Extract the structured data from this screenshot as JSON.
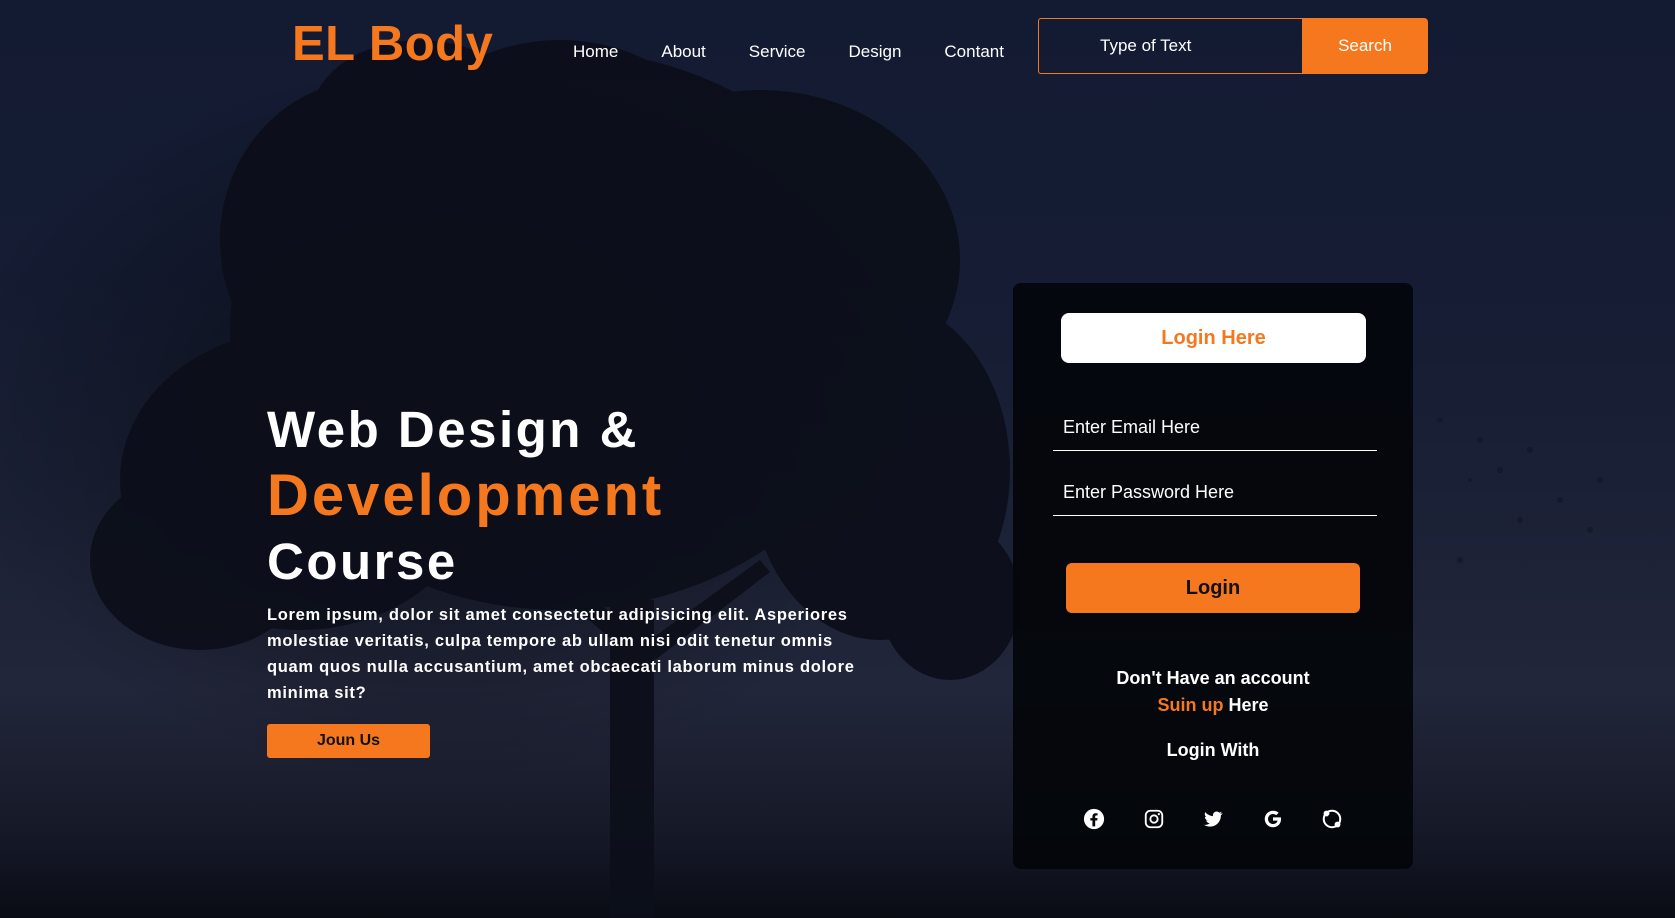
{
  "brand": {
    "logo": "EL Body",
    "accent": "#f5781e"
  },
  "nav": {
    "items": [
      {
        "label": "Home"
      },
      {
        "label": "About"
      },
      {
        "label": "Service"
      },
      {
        "label": "Design"
      },
      {
        "label": "Contant"
      }
    ]
  },
  "search": {
    "placeholder": "Type of Text",
    "button_label": "Search"
  },
  "hero": {
    "line1": "Web Design &",
    "line2": "Development",
    "line3": "Course",
    "paragraph": "Lorem ipsum, dolor sit amet consectetur adipisicing elit. Asperiores molestiae veritatis, culpa tempore ab ullam nisi odit tenetur omnis quam quos nulla accusantium, amet obcaecati laborum minus dolore minima sit?",
    "join_label": "Joun Us"
  },
  "login": {
    "title": "Login Here",
    "email_placeholder": "Enter Email Here",
    "password_placeholder": "Enter Password Here",
    "button_label": "Login",
    "no_account": "Don't Have an account",
    "signup_link": "Suin up",
    "signup_suffix": " Here",
    "login_with": "Login With",
    "socials": [
      "facebook-icon",
      "instagram-icon",
      "twitter-icon",
      "google-icon",
      "skype-icon"
    ]
  }
}
